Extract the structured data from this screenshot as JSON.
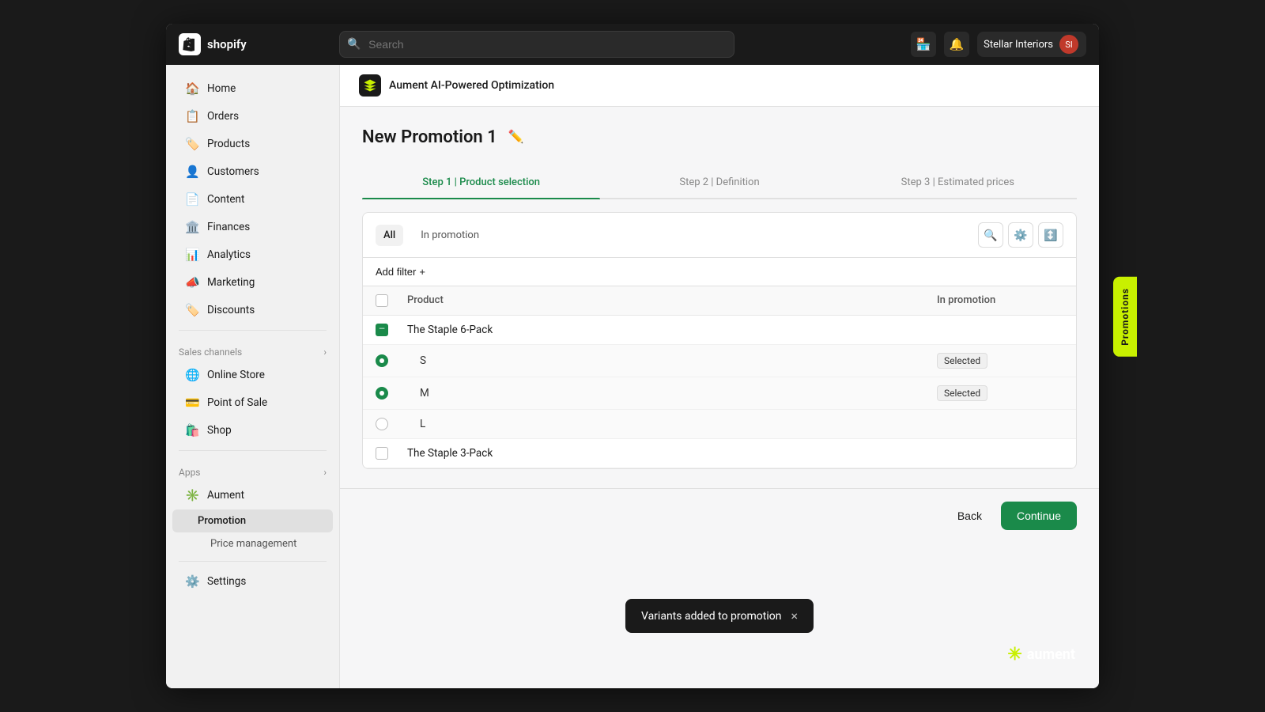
{
  "colors": {
    "accent_green": "#1a8a4a",
    "lime_yellow": "#c8f000",
    "dark_bg": "#1a1a1a",
    "sidebar_bg": "#f1f1f1",
    "white": "#ffffff"
  },
  "topbar": {
    "logo_text": "shopify",
    "search_placeholder": "Search",
    "store_name": "Stellar Interiors"
  },
  "sidebar": {
    "items": [
      {
        "id": "home",
        "label": "Home",
        "icon": "🏠"
      },
      {
        "id": "orders",
        "label": "Orders",
        "icon": "📋"
      },
      {
        "id": "products",
        "label": "Products",
        "icon": "🏷️"
      },
      {
        "id": "customers",
        "label": "Customers",
        "icon": "👤"
      },
      {
        "id": "content",
        "label": "Content",
        "icon": "📄"
      },
      {
        "id": "finances",
        "label": "Finances",
        "icon": "🏛️"
      },
      {
        "id": "analytics",
        "label": "Analytics",
        "icon": "📊"
      },
      {
        "id": "marketing",
        "label": "Marketing",
        "icon": "📣"
      },
      {
        "id": "discounts",
        "label": "Discounts",
        "icon": "🏷️"
      }
    ],
    "sales_channels_label": "Sales channels",
    "sales_channels": [
      {
        "id": "online-store",
        "label": "Online Store",
        "icon": "🌐"
      },
      {
        "id": "point-of-sale",
        "label": "Point of Sale",
        "icon": "💳"
      },
      {
        "id": "shop",
        "label": "Shop",
        "icon": "🛍️"
      }
    ],
    "apps_label": "Apps",
    "apps": [
      {
        "id": "aument",
        "label": "Aument",
        "icon": "✳️"
      },
      {
        "id": "promotion",
        "label": "Promotion",
        "active": true
      },
      {
        "id": "price-management",
        "label": "Price management"
      }
    ],
    "settings_label": "Settings"
  },
  "app_header": {
    "title": "Aument AI-Powered Optimization"
  },
  "page": {
    "title": "New Promotion 1",
    "steps": [
      {
        "label": "Step 1 | Product selection",
        "active": true
      },
      {
        "label": "Step 2 | Definition",
        "active": false
      },
      {
        "label": "Step 3 | Estimated prices",
        "active": false
      }
    ],
    "tabs": [
      {
        "label": "All",
        "active": true
      },
      {
        "label": "In promotion",
        "active": false
      }
    ],
    "add_filter_label": "Add filter",
    "table": {
      "headers": [
        "Product",
        "In promotion"
      ],
      "rows": [
        {
          "id": "staple-6",
          "type": "parent",
          "name": "The Staple 6-Pack",
          "in_promotion": ""
        },
        {
          "id": "staple-6-s",
          "type": "child",
          "name": "S",
          "in_promotion": "Selected",
          "checked": true
        },
        {
          "id": "staple-6-m",
          "type": "child",
          "name": "M",
          "in_promotion": "Selected",
          "checked": true
        },
        {
          "id": "staple-6-l",
          "type": "child",
          "name": "L",
          "in_promotion": "",
          "checked": false
        },
        {
          "id": "staple-3",
          "type": "parent",
          "name": "The Staple 3-Pack",
          "in_promotion": ""
        }
      ]
    },
    "back_label": "Back",
    "continue_label": "Continue"
  },
  "toast": {
    "message": "Variants added to promotion",
    "close_icon": "×"
  },
  "promotions_tab": {
    "label": "Promotions"
  },
  "aument_logo": {
    "text": "aument"
  }
}
